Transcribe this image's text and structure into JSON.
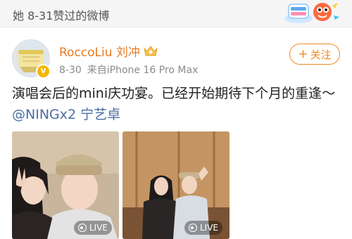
{
  "header": {
    "title": "她 8-31赞过的微博"
  },
  "post": {
    "author": "RoccoLiu 刘冲",
    "date": "8-30",
    "source": "来自iPhone 16 Pro Max",
    "follow_label": "关注",
    "follow_plus": "+",
    "text_main": "演唱会后的mini庆功宴。已经开始期待下个月的重逢～ ",
    "mention": "@NINGx2 宁艺卓",
    "photos": [
      {
        "live_label": "LIVE"
      },
      {
        "live_label": "LIVE"
      }
    ]
  },
  "colors": {
    "accent_orange": "#f08a24",
    "author_name": "#eb7a1f",
    "mention_blue": "#4b6ea4"
  }
}
